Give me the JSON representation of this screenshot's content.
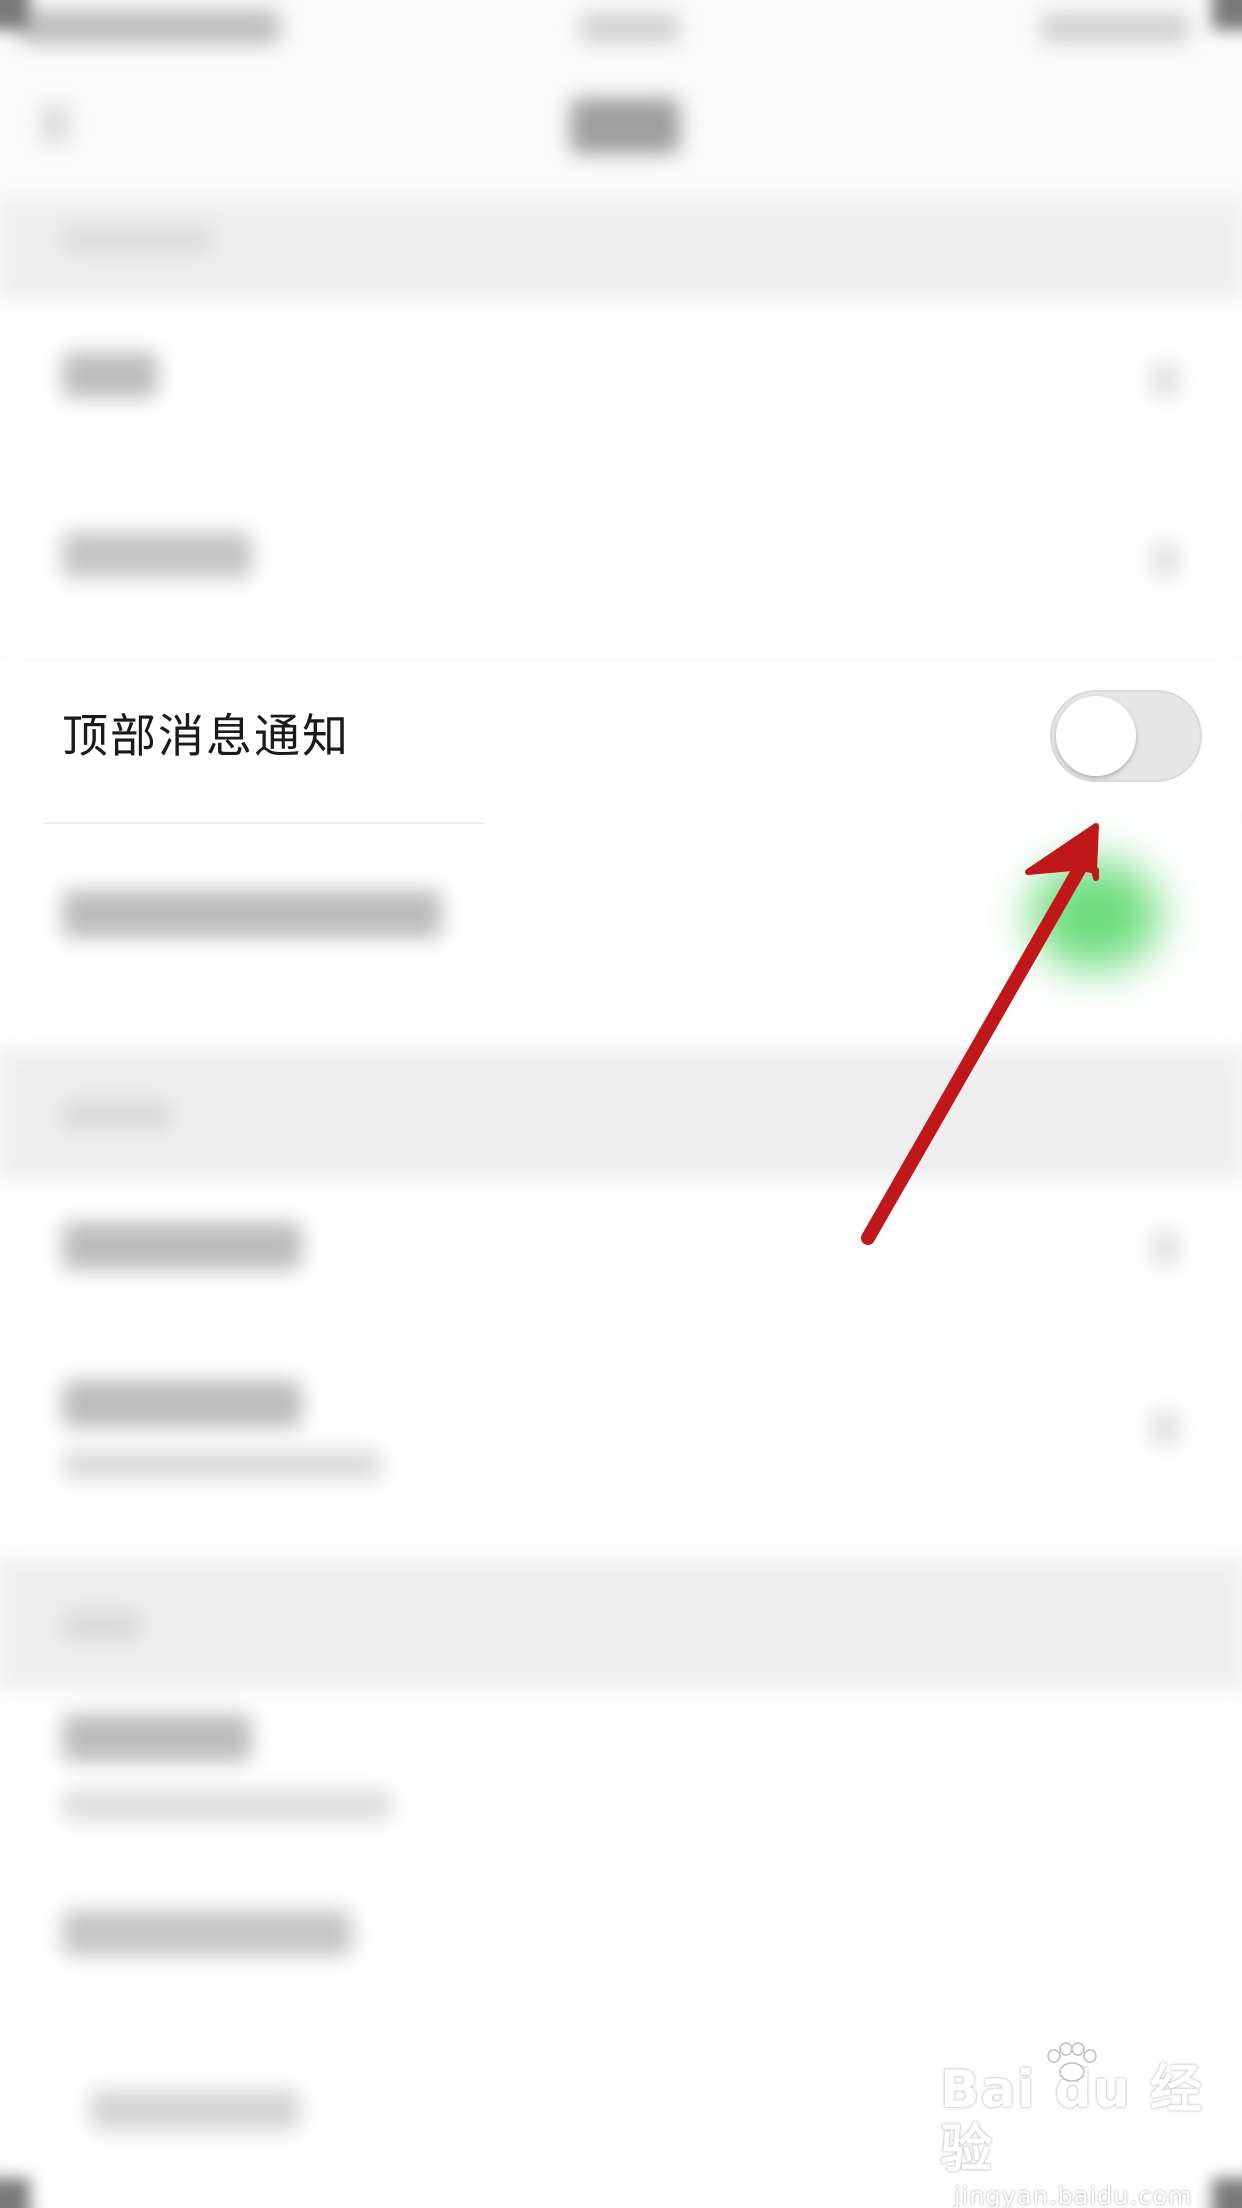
{
  "settings": {
    "top_notification": {
      "label": "顶部消息通知",
      "enabled": false
    }
  },
  "colors": {
    "arrow": "#c0181a",
    "toggle_off": "#e6e6e6",
    "green_glow": "#55d668"
  },
  "watermark": {
    "brand": "Bai du 经验",
    "url": "jingyan.baidu.com"
  }
}
